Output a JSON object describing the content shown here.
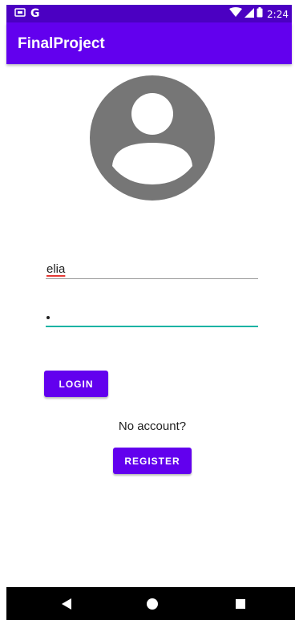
{
  "status_bar": {
    "carrier_label": "G",
    "time": "2:24",
    "icons": [
      "sim-card-icon",
      "wifi-icon",
      "signal-icon",
      "battery-icon"
    ]
  },
  "app_bar": {
    "title": "FinalProject"
  },
  "avatar": {
    "icon": "account-circle-icon"
  },
  "login_form": {
    "username_value": "elia",
    "password_mask": "•",
    "login_label": "LOGIN",
    "no_account_text": "No account?",
    "register_label": "REGISTER"
  },
  "nav_bar": {
    "icons": [
      "back-icon",
      "home-icon",
      "recents-icon"
    ]
  },
  "colors": {
    "primary": "#6200ee",
    "status_bar": "#4b00c2",
    "focus_accent": "#17b3a3",
    "avatar_gray": "#767676"
  }
}
